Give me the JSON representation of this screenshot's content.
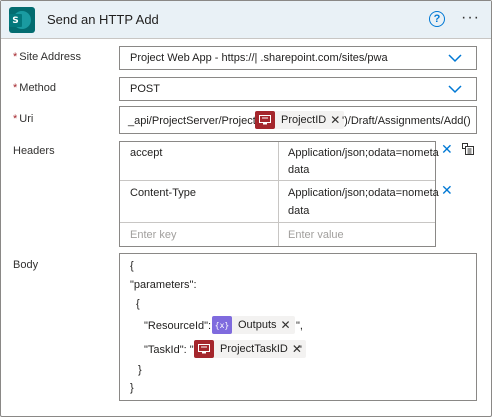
{
  "header": {
    "title": "Send an HTTP Add",
    "help_glyph": "?",
    "more_glyph": "···",
    "app_letter": "S"
  },
  "site": {
    "label": "Site Address",
    "value": "Project Web App - https://|                    .sharepoint.com/sites/pwa"
  },
  "method": {
    "label": "Method",
    "value": "POST"
  },
  "uri": {
    "label": "Uri",
    "prefix": "_api/ProjectServer/Projects('",
    "token": "ProjectID",
    "suffix": "')/Draft/Assignments/Add()"
  },
  "headers": {
    "label": "Headers",
    "rows": [
      {
        "key": "accept",
        "value_line1": "Application/json;odata=nometa",
        "value_line2": "data"
      },
      {
        "key": "Content-Type",
        "value_line1": "Application/json;odata=nometa",
        "value_line2": "data"
      }
    ],
    "key_placeholder": "Enter key",
    "value_placeholder": "Enter value"
  },
  "body": {
    "label": "Body",
    "open_brace": "{",
    "parameters_line": "\"parameters\":",
    "inner_open": "{",
    "resource_prefix": "\"ResourceId\": \"",
    "resource_token": "Outputs",
    "resource_suffix": "\",",
    "task_prefix": "\"TaskId\": \"",
    "task_token": "ProjectTaskID",
    "task_suffix": "\"",
    "inner_close": "}",
    "close_brace": "}",
    "expression_glyph": "{x}"
  },
  "common": {
    "required_mark": "*",
    "remove_glyph": "✕"
  },
  "colors": {
    "header_bg": "#e9f1f6",
    "sharepoint_teal": "#036c70",
    "accent_blue": "#0078d4",
    "required_red": "#a4262c",
    "expression_purple": "#7f6bde"
  }
}
